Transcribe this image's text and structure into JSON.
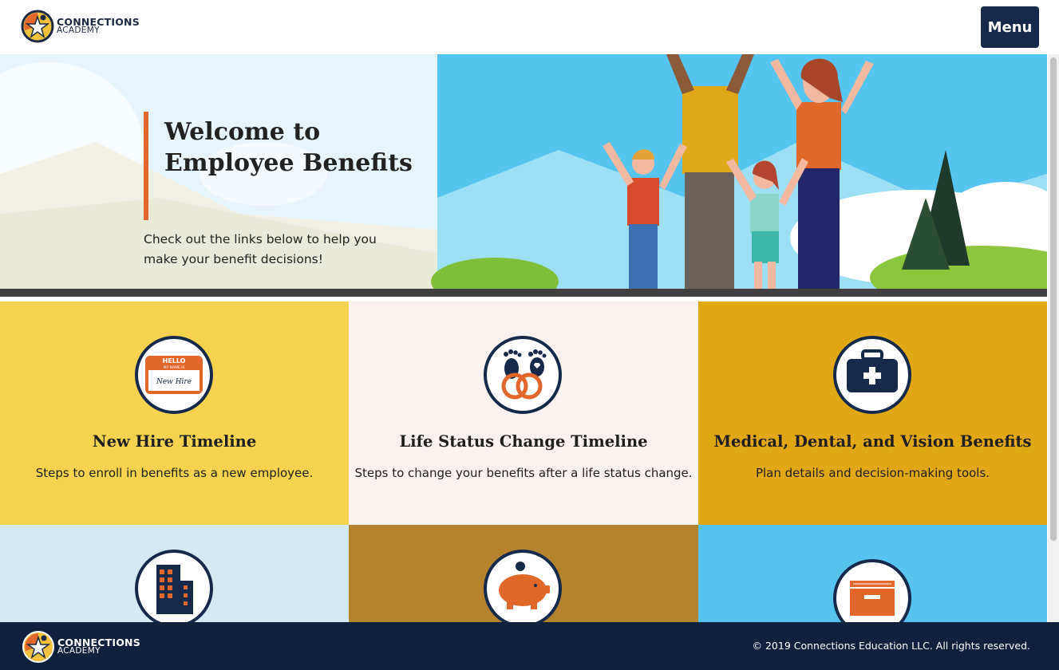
{
  "header": {
    "logo_line1": "CONNECTIONS",
    "logo_line2": "ACADEMY",
    "menu_label": "Menu"
  },
  "hero": {
    "title": "Welcome to Employee Benefits",
    "subtitle": "Check out the links below to help you make your benefit decisions!"
  },
  "tiles": [
    {
      "title": "New Hire Timeline",
      "desc": "Steps to enroll in benefits as a new employee.",
      "icon": "name-tag-icon",
      "badge_hello": "HELLO",
      "badge_sub": "MY NAME IS",
      "badge_name": "New Hire",
      "bg": "#f5d34f"
    },
    {
      "title": "Life Status Change Timeline",
      "desc": "Steps to change your benefits after a life status change.",
      "icon": "rings-footprints-icon",
      "bg": "#f9f2ee"
    },
    {
      "title": "Medical, Dental, and Vision Benefits",
      "desc": "Plan details and decision-making tools.",
      "icon": "medical-kit-icon",
      "bg": "#e1a714"
    },
    {
      "title": "",
      "desc": "",
      "icon": "building-icon",
      "bg": "#d3e9f3"
    },
    {
      "title": "",
      "desc": "",
      "icon": "piggy-bank-icon",
      "bg": "#b5832e"
    },
    {
      "title": "",
      "desc": "",
      "icon": "file-drawer-icon",
      "bg": "#57c3f0"
    }
  ],
  "footer": {
    "logo_line1": "CONNECTIONS",
    "logo_line2": "ACADEMY",
    "copyright": "© 2019 Connections Education LLC. All rights reserved."
  },
  "colors": {
    "navy": "#15294b",
    "orange": "#e2672a",
    "footer_bg": "#0f213d"
  }
}
